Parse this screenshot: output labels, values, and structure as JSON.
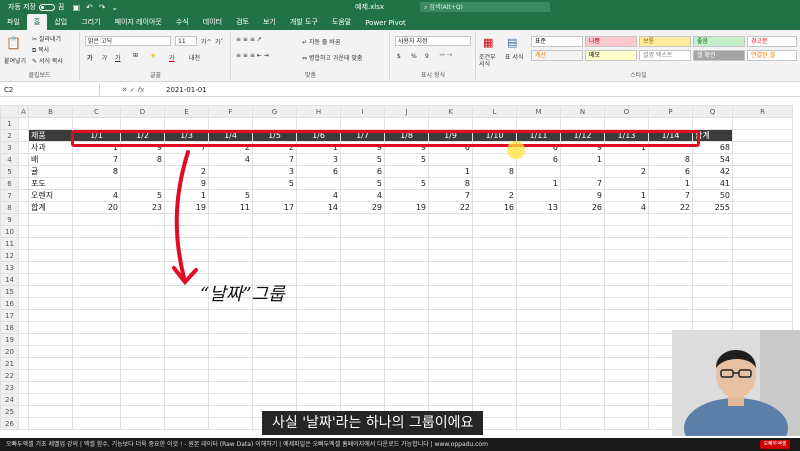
{
  "titlebar": {
    "autosave_label": "자동 저장",
    "autosave_state": "끔",
    "doc_title": "예제.xlsx",
    "search_placeholder": "검색(Alt+Q)"
  },
  "menu": {
    "tabs": [
      "파일",
      "홈",
      "삽입",
      "그리기",
      "페이지 레이아웃",
      "수식",
      "데이터",
      "검토",
      "보기",
      "개발 도구",
      "도움말",
      "Power Pivot"
    ],
    "active": "홈"
  },
  "ribbon": {
    "clipboard": {
      "label": "클립보드",
      "paste": "붙여넣기",
      "cut": "잘라내기",
      "copy": "복사",
      "format_painter": "서식 복사"
    },
    "font": {
      "label": "글꼴",
      "font_name": "맑은 고딕",
      "font_size": "11",
      "grow": "가^",
      "shrink": "가ˇ",
      "bold": "가",
      "italic": "가",
      "underline": "가",
      "text_color_glyph": "가",
      "phonetic": "내천"
    },
    "alignment": {
      "label": "맞춤",
      "wrap": "자동 줄 바꿈",
      "merge": "병합하고 가운데 맞춤"
    },
    "number": {
      "label": "표시 형식",
      "format": "사용자 지정",
      "currency": "$",
      "percent": "%",
      "comma": "9"
    },
    "styles": {
      "label": "스타일",
      "conditional": "조건부 서식",
      "table": "표 서식",
      "cells": [
        {
          "text": "표준",
          "bg": "#ffffff",
          "fg": "#000000"
        },
        {
          "text": "나쁨",
          "bg": "#ffc7ce",
          "fg": "#9c0006"
        },
        {
          "text": "보통",
          "bg": "#ffeb9c",
          "fg": "#9c5700"
        },
        {
          "text": "좋음",
          "bg": "#c6efce",
          "fg": "#006100"
        },
        {
          "text": "경고문",
          "bg": "#ffffff",
          "fg": "#ff0000"
        },
        {
          "text": "계산",
          "bg": "#f2f2f2",
          "fg": "#fa7d00"
        },
        {
          "text": "메모",
          "bg": "#ffffcc",
          "fg": "#000000"
        },
        {
          "text": "설명 텍스트",
          "bg": "#ffffff",
          "fg": "#7f7f7f"
        },
        {
          "text": "셀 확인",
          "bg": "#a5a5a5",
          "fg": "#ffffff"
        },
        {
          "text": "연결된 셀",
          "bg": "#ffffff",
          "fg": "#fa7d00"
        }
      ]
    }
  },
  "formulabar": {
    "cell_ref": "C2",
    "fx": "fx",
    "value": "2021-01-01"
  },
  "sheet": {
    "columns": [
      "A",
      "B",
      "C",
      "D",
      "E",
      "F",
      "G",
      "H",
      "I",
      "J",
      "K",
      "L",
      "M",
      "N",
      "O",
      "P",
      "Q",
      "R"
    ],
    "rows": [
      {
        "n": "1",
        "label": "",
        "vals": [
          "",
          "",
          "",
          "",
          "",
          "",
          "",
          "",
          "",
          "",
          "",
          "",
          "",
          ""
        ],
        "total": "",
        "dark": false
      },
      {
        "n": "2",
        "label": "제품",
        "vals": [
          "1/1",
          "1/2",
          "1/3",
          "1/4",
          "1/5",
          "1/6",
          "1/7",
          "1/8",
          "1/9",
          "1/10",
          "1/11",
          "1/12",
          "1/13",
          "1/14"
        ],
        "total": "합계",
        "dark": true
      },
      {
        "n": "3",
        "label": "사과",
        "vals": [
          "1",
          "9",
          "7",
          "2",
          "2",
          "1",
          "9",
          "9",
          "6",
          "",
          "6",
          "9",
          "1",
          ""
        ],
        "total": "68",
        "dark": false
      },
      {
        "n": "4",
        "label": "배",
        "vals": [
          "7",
          "8",
          "",
          "4",
          "7",
          "3",
          "5",
          "5",
          "",
          "",
          "6",
          "1",
          "",
          "8"
        ],
        "total": "54",
        "dark": false
      },
      {
        "n": "5",
        "label": "귤",
        "vals": [
          "8",
          "",
          "2",
          "",
          "3",
          "6",
          "6",
          "",
          "1",
          "8",
          "",
          "",
          "2",
          "6"
        ],
        "total": "42",
        "dark": false
      },
      {
        "n": "6",
        "label": "포도",
        "vals": [
          "",
          "",
          "9",
          "",
          "5",
          "",
          "5",
          "5",
          "8",
          "",
          "1",
          "7",
          "",
          "1"
        ],
        "total": "41",
        "dark": false
      },
      {
        "n": "7",
        "label": "오렌지",
        "vals": [
          "4",
          "5",
          "1",
          "5",
          "",
          "4",
          "4",
          "",
          "7",
          "2",
          "",
          "9",
          "1",
          "7"
        ],
        "total": "50",
        "dark": false
      },
      {
        "n": "8",
        "label": "합계",
        "vals": [
          "20",
          "23",
          "19",
          "11",
          "17",
          "14",
          "29",
          "19",
          "22",
          "16",
          "13",
          "26",
          "4",
          "22"
        ],
        "total": "255",
        "dark": false,
        "sum": true
      },
      {
        "n": "9"
      },
      {
        "n": "10"
      },
      {
        "n": "11"
      },
      {
        "n": "12"
      },
      {
        "n": "13"
      },
      {
        "n": "14"
      },
      {
        "n": "15"
      },
      {
        "n": "16"
      },
      {
        "n": "17"
      },
      {
        "n": "18"
      },
      {
        "n": "19"
      },
      {
        "n": "20"
      },
      {
        "n": "21"
      },
      {
        "n": "22"
      },
      {
        "n": "23"
      },
      {
        "n": "24"
      },
      {
        "n": "25"
      },
      {
        "n": "26"
      }
    ]
  },
  "annotation": {
    "note": "“날짜”그룹"
  },
  "caption": "사실 '날짜'라는 하나의 그룹이에요",
  "banner": "오빠두엑셀 기초 레벨업 강의 | 엑셀 함수, 기능보다 더욱 중요한 이것 ! - 원본 데이터 (Raw Data) 이해하기 | 예제파일은 오빠두엑셀 홈페이지에서 다운로드 가능합니다 | www.oppadu.com",
  "brand_badge": "오빠두엑셀",
  "colors": {
    "excel_green": "#217346",
    "highlight_red": "#e10b22",
    "header_dark": "#3b3b3b"
  }
}
